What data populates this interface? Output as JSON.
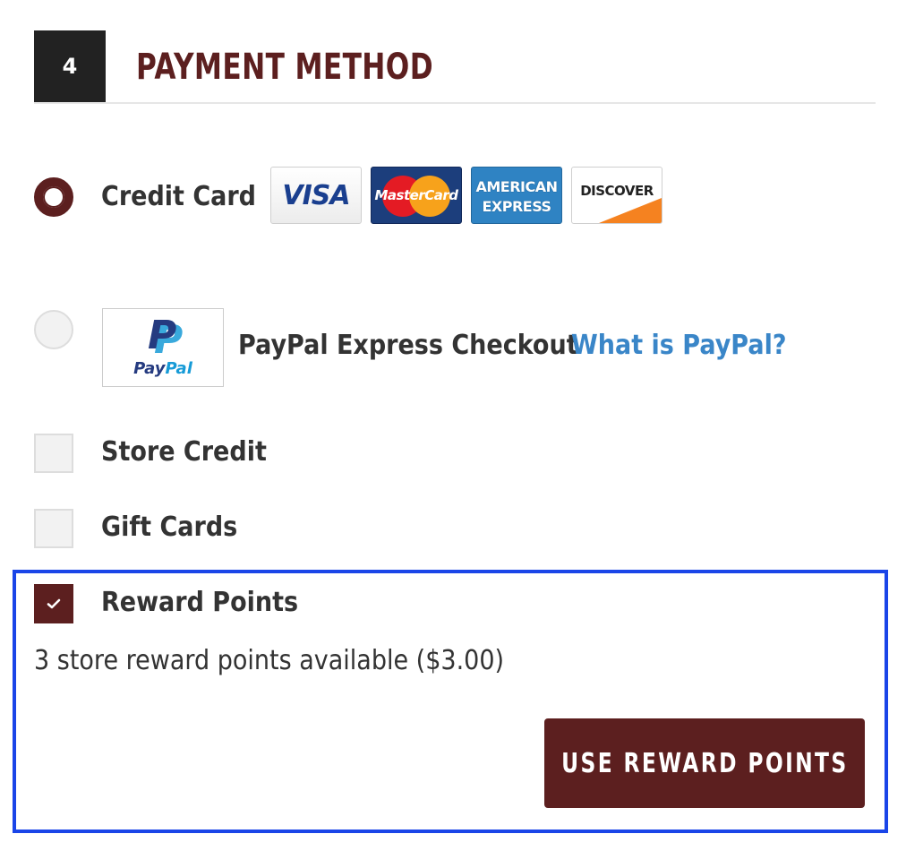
{
  "header": {
    "step_number": "4",
    "title": "PAYMENT METHOD"
  },
  "payment_options": {
    "credit_card": {
      "label": "Credit Card",
      "selected": true,
      "cards": [
        "VISA",
        "MasterCard",
        "AMERICAN",
        "EXPRESS",
        "DISCOVER"
      ]
    },
    "paypal": {
      "logo_text_pay": "Pay",
      "logo_text_pal": "Pal",
      "label": "PayPal Express Checkout",
      "link_label": "What is PayPal?",
      "selected": false
    },
    "store_credit": {
      "label": "Store Credit",
      "checked": false
    },
    "gift_cards": {
      "label": "Gift Cards",
      "checked": false
    },
    "reward_points": {
      "label": "Reward Points",
      "checked": true,
      "available_text": "3 store reward points available ($3.00)",
      "button_label": "USE REWARD POINTS"
    }
  },
  "colors": {
    "brand": "#5c1f1f",
    "link": "#3a86c8",
    "highlight_border": "#1a45e8",
    "step_box": "#222222"
  },
  "icons": [
    "check-icon",
    "paypal-logo",
    "visa-logo",
    "mastercard-logo",
    "amex-logo",
    "discover-logo"
  ]
}
